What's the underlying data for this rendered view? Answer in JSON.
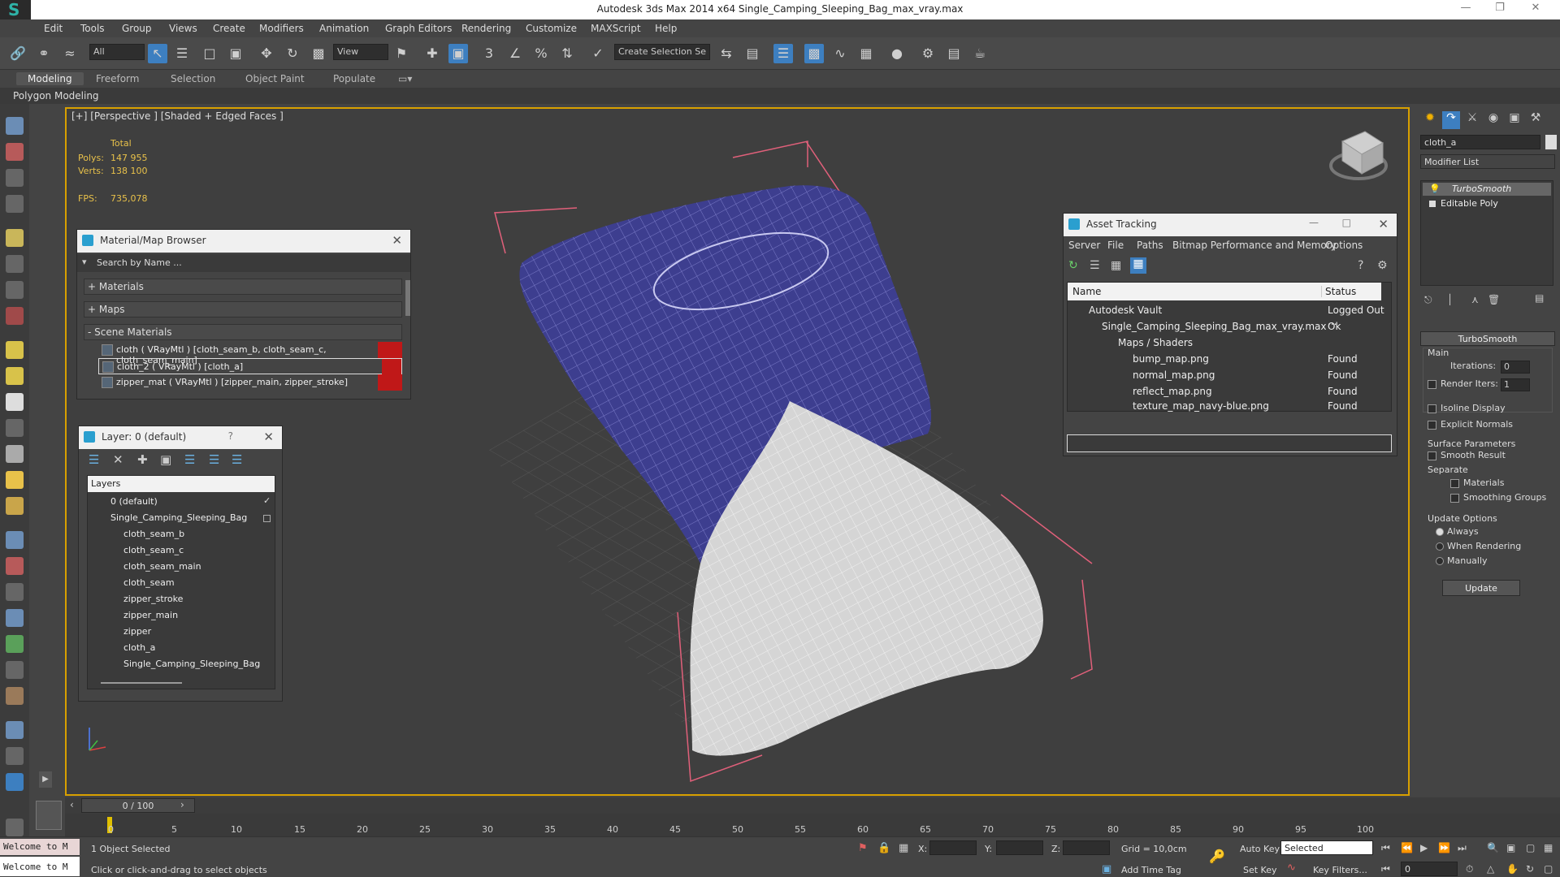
{
  "window": {
    "title": "Autodesk 3ds Max  2014 x64     Single_Camping_Sleeping_Bag_max_vray.max"
  },
  "menu": [
    "Edit",
    "Tools",
    "Group",
    "Views",
    "Create",
    "Modifiers",
    "Animation",
    "Graph Editors",
    "Rendering",
    "Customize",
    "MAXScript",
    "Help"
  ],
  "toolbar": {
    "filter_select": "All",
    "view_select": "View",
    "selection_set_placeholder": "Create Selection Se"
  },
  "ribbon": {
    "tabs": [
      "Modeling",
      "Freeform",
      "Selection",
      "Object Paint",
      "Populate"
    ],
    "sub_label": "Polygon Modeling"
  },
  "viewport": {
    "label": "[+] [Perspective ] [Shaded + Edged Faces ]",
    "stats": {
      "total_label": "Total",
      "polys_label": "Polys:",
      "polys_value": "147 955",
      "verts_label": "Verts:",
      "verts_value": "138 100",
      "fps_label": "FPS:",
      "fps_value": "735,078"
    }
  },
  "material_browser": {
    "title": "Material/Map Browser",
    "search_placeholder": "Search by Name ...",
    "groups": [
      "+ Materials",
      "+ Maps",
      "- Scene Materials"
    ],
    "items": [
      "cloth  ( VRayMtl )  [cloth_seam_b, cloth_seam_c, cloth_seam_main]",
      "cloth_2  ( VRayMtl )  [cloth_a]",
      "zipper_mat  ( VRayMtl )  [zipper_main, zipper_stroke]"
    ]
  },
  "layers": {
    "title": "Layer: 0 (default)",
    "help": "?",
    "header": "Layers",
    "items": [
      "0 (default)",
      "Single_Camping_Sleeping_Bag",
      "cloth_seam_b",
      "cloth_seam_c",
      "cloth_seam_main",
      "cloth_seam",
      "zipper_stroke",
      "zipper_main",
      "zipper",
      "cloth_a",
      "Single_Camping_Sleeping_Bag"
    ]
  },
  "asset_tracking": {
    "title": "Asset Tracking",
    "menu": [
      "Server",
      "File",
      "Paths",
      "Bitmap Performance and Memory",
      "Options"
    ],
    "col_name": "Name",
    "col_status": "Status",
    "rows": [
      {
        "name": "Autodesk Vault",
        "status": "Logged Out ..."
      },
      {
        "name": "Single_Camping_Sleeping_Bag_max_vray.max",
        "status": "Ok"
      },
      {
        "name": "Maps / Shaders",
        "status": ""
      },
      {
        "name": "bump_map.png",
        "status": "Found"
      },
      {
        "name": "normal_map.png",
        "status": "Found"
      },
      {
        "name": "reflect_map.png",
        "status": "Found"
      },
      {
        "name": "texture_map_navy-blue.png",
        "status": "Found"
      }
    ]
  },
  "command_panel": {
    "object_name": "cloth_a",
    "modifier_list": "Modifier List",
    "stack": [
      "TurboSmooth",
      "Editable Poly"
    ],
    "rollout_title": "TurboSmooth",
    "main_label": "Main",
    "iterations_label": "Iterations:",
    "iterations_value": "0",
    "render_iters_label": "Render Iters:",
    "render_iters_value": "1",
    "isoline_label": "Isoline Display",
    "explicit_normals_label": "Explicit Normals",
    "surface_params_label": "Surface Parameters",
    "smooth_result_label": "Smooth Result",
    "separate_label": "Separate",
    "materials_label": "Materials",
    "smoothing_groups_label": "Smoothing Groups",
    "update_options_label": "Update Options",
    "always_label": "Always",
    "when_rendering_label": "When Rendering",
    "manually_label": "Manually",
    "update_button": "Update"
  },
  "timeline": {
    "frame_display": "0 / 100",
    "ticks": [
      "0",
      "5",
      "10",
      "15",
      "20",
      "25",
      "30",
      "35",
      "40",
      "45",
      "50",
      "55",
      "60",
      "65",
      "70",
      "75",
      "80",
      "85",
      "90",
      "95",
      "100"
    ]
  },
  "status": {
    "maxscript": "Welcome to M",
    "selected": "1 Object Selected",
    "prompt": "Click or click-and-drag to select objects",
    "x_label": "X:",
    "y_label": "Y:",
    "z_label": "Z:",
    "grid": "Grid = 10,0cm",
    "add_time_tag": "Add Time Tag",
    "auto_key": "Auto Key",
    "set_key": "Set Key",
    "selected_dropdown": "Selected",
    "key_filters": "Key Filters...",
    "frame_value": "0"
  },
  "colors": {
    "viewport_border": "#d8a000",
    "stats_yellow": "#e8c14a",
    "bag_blue": "#3d3e8f",
    "bag_white": "#d5d5d5",
    "bbox_pink": "#e0607a",
    "material_red": "#c01818"
  }
}
